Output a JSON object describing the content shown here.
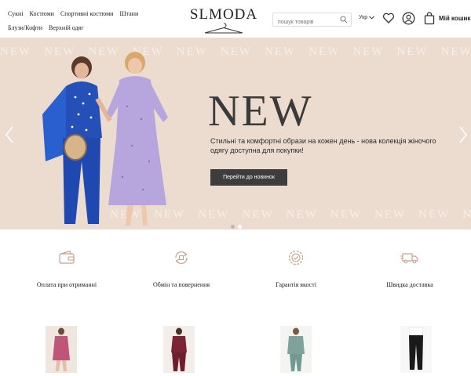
{
  "header": {
    "nav": [
      "Сукні",
      "Костюми",
      "Спортивні костюми",
      "Штани",
      "Блузи/Кофти",
      "Верхній одяг"
    ],
    "logo": "SLMODA",
    "search_placeholder": "пошук товарів",
    "language": "Укр",
    "cart_label": "Мій кошик"
  },
  "hero": {
    "watermark": "NEW",
    "title": "NEW",
    "description": "Стильні та комфортні образи на кожен день - нова колекція жіночого одягу доступна для покупки!",
    "button_label": "Перейти до новинок",
    "slides_total": 2,
    "active_slide": 1,
    "background": "#ecdcd0"
  },
  "features": [
    {
      "label": "Оплата при отриманні",
      "icon": "wallet-icon"
    },
    {
      "label": "Обмін та повернення",
      "icon": "exchange-icon"
    },
    {
      "label": "Гарантія якості",
      "icon": "quality-badge-icon"
    },
    {
      "label": "Швидка доставка",
      "icon": "delivery-truck-icon"
    }
  ],
  "products": [
    {
      "image": "pink-dress-photo",
      "color": "#c0557a"
    },
    {
      "image": "burgundy-suit-photo",
      "color": "#7c2334"
    },
    {
      "image": "sage-suit-photo",
      "color": "#7fa39a"
    },
    {
      "image": "black-pants-photo",
      "color": "#1a1a1a"
    }
  ],
  "colors": {
    "accent_icon": "#c9a08a",
    "button": "#3d3d3d",
    "text": "#222222"
  }
}
